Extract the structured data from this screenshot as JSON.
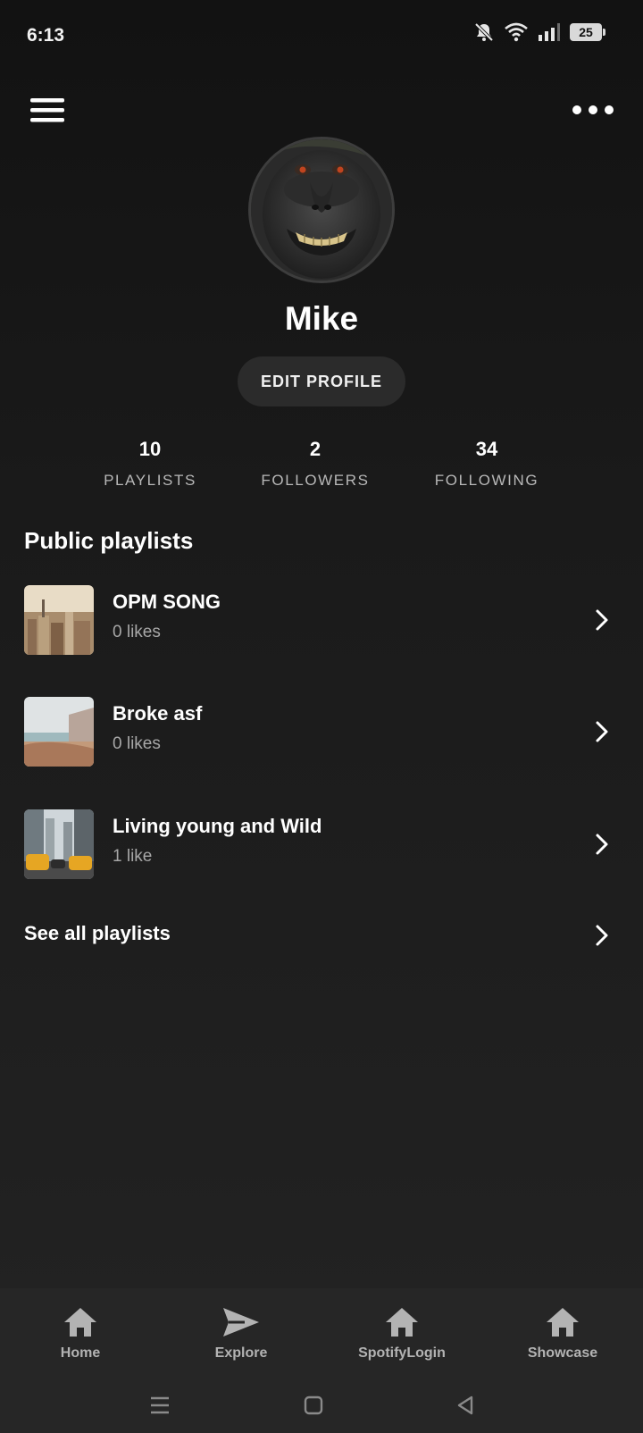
{
  "status_bar": {
    "time": "6:13",
    "battery": "25",
    "icons": [
      "bell-muted-icon",
      "wifi-icon",
      "signal-icon",
      "battery-icon"
    ]
  },
  "header": {
    "menu_icon": "hamburger-menu-icon",
    "more_icon": "more-options-icon"
  },
  "profile": {
    "name": "Mike",
    "edit_label": "EDIT PROFILE",
    "avatar_description_icon": "avatar-monkey"
  },
  "stats": [
    {
      "value": "10",
      "label": "PLAYLISTS"
    },
    {
      "value": "2",
      "label": "FOLLOWERS"
    },
    {
      "value": "34",
      "label": "FOLLOWING"
    }
  ],
  "playlists_section": {
    "title": "Public playlists",
    "items": [
      {
        "title": "OPM SONG",
        "subtitle": "0 likes"
      },
      {
        "title": "Broke asf",
        "subtitle": "0 likes"
      },
      {
        "title": "Living young and Wild",
        "subtitle": "1 like"
      }
    ],
    "see_all_label": "See all playlists"
  },
  "bottom_nav": {
    "items": [
      {
        "label": "Home",
        "icon": "home-icon"
      },
      {
        "label": "Explore",
        "icon": "send-icon"
      },
      {
        "label": "SpotifyLogin",
        "icon": "home-icon"
      },
      {
        "label": "Showcase",
        "icon": "home-icon"
      }
    ]
  },
  "system_nav": [
    "recents-icon",
    "home-square-icon",
    "back-triangle-icon"
  ],
  "colors": {
    "background_top": "#121212",
    "background_bottom": "#232323",
    "text_primary": "#ffffff",
    "text_secondary": "#a7a7a7",
    "button_bg": "#2b2b2b",
    "nav_bg": "#262626"
  }
}
